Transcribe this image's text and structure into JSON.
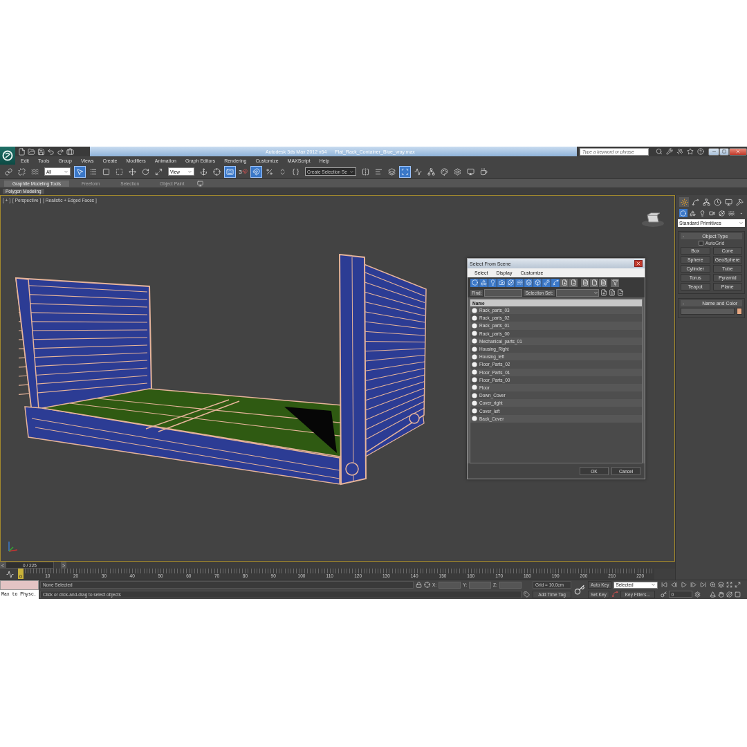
{
  "window": {
    "app_title": "Autodesk 3ds Max  2012 x64",
    "file_title": "Flat_Rack_Container_Blue_vray.max",
    "search_placeholder": "Type a keyword or phrase"
  },
  "menu": [
    "Edit",
    "Tools",
    "Group",
    "Views",
    "Create",
    "Modifiers",
    "Animation",
    "Graph Editors",
    "Rendering",
    "Customize",
    "MAXScript",
    "Help"
  ],
  "toolbar": [
    {
      "kind": "button",
      "active": false
    },
    {
      "kind": "button",
      "active": false
    },
    {
      "kind": "button",
      "active": false
    },
    {
      "kind": "dropdown",
      "value": "All"
    },
    {
      "kind": "button",
      "active": true
    },
    {
      "kind": "button",
      "active": false
    },
    {
      "kind": "button",
      "active": false
    },
    {
      "kind": "button",
      "active": false
    },
    {
      "kind": "button",
      "active": false
    },
    {
      "kind": "button",
      "active": false
    },
    {
      "kind": "button",
      "active": false
    },
    {
      "kind": "dropdown",
      "value": "View"
    },
    {
      "kind": "button",
      "active": false
    },
    {
      "kind": "button",
      "active": false
    },
    {
      "kind": "button",
      "active": true
    },
    {
      "kind": "text",
      "label": "3",
      "active": false
    },
    {
      "kind": "button",
      "active": true
    },
    {
      "kind": "button",
      "active": false
    },
    {
      "kind": "button",
      "active": false
    },
    {
      "kind": "button",
      "active": false
    },
    {
      "kind": "dropdown",
      "value": "Create Selection Se"
    },
    {
      "kind": "button",
      "active": false
    },
    {
      "kind": "button",
      "active": false
    },
    {
      "kind": "button",
      "active": false
    },
    {
      "kind": "button",
      "active": true
    },
    {
      "kind": "button",
      "active": false
    },
    {
      "kind": "button",
      "active": false
    },
    {
      "kind": "button",
      "active": false
    },
    {
      "kind": "button",
      "active": false
    },
    {
      "kind": "button",
      "active": false
    },
    {
      "kind": "button",
      "active": false
    }
  ],
  "ribbon": {
    "tabs": [
      {
        "label": "Graphite Modeling Tools",
        "selected": true
      },
      {
        "label": "Freeform",
        "selected": false
      },
      {
        "label": "Selection",
        "selected": false
      },
      {
        "label": "Object Paint",
        "selected": false
      }
    ],
    "panel": "Polygon Modeling"
  },
  "viewport": {
    "labels": [
      "[ + ]",
      "[ Perspective ]",
      "[ Realistic + Edged Faces ]"
    ]
  },
  "dialog": {
    "title": "Select From Scene",
    "menu": [
      "Select",
      "Display",
      "Customize"
    ],
    "tools": [
      {
        "active": true
      },
      {
        "active": true
      },
      {
        "active": true
      },
      {
        "active": true
      },
      {
        "active": true
      },
      {
        "active": true
      },
      {
        "active": true
      },
      {
        "active": true
      },
      {
        "active": true
      },
      {
        "active": true
      },
      {
        "active": false
      },
      {
        "active": false
      },
      {
        "active": false
      },
      {
        "active": false
      },
      {
        "active": false
      },
      {
        "active": false
      }
    ],
    "find_label": "Find:",
    "selection_set_label": "Selection Set:",
    "column": "Name",
    "items": [
      "Rack_parts_03",
      "Rack_parts_02",
      "Rack_parts_01",
      "Rack_parts_00",
      "Mechanical_parts_01",
      "Housing_Right",
      "Housing_left",
      "Floor_Parts_02",
      "Floor_Parts_01",
      "Floor_Parts_00",
      "Floor",
      "Down_Cover",
      "Cover_right",
      "Cover_left",
      "Back_Cover"
    ],
    "buttons": [
      "OK",
      "Cancel"
    ]
  },
  "command_panel": {
    "tabs": [
      {
        "selected": true
      },
      {
        "selected": false
      },
      {
        "selected": false
      },
      {
        "selected": false
      },
      {
        "selected": false
      },
      {
        "selected": false
      }
    ],
    "categories": [
      {
        "selected": true
      },
      {
        "selected": false
      },
      {
        "selected": false
      },
      {
        "selected": false
      },
      {
        "selected": false
      },
      {
        "selected": false
      },
      {
        "selected": false
      }
    ],
    "type": "Standard Primitives",
    "object_type": {
      "toggle": "-",
      "title": "Object Type",
      "autogrid": {
        "label": "AutoGrid",
        "checked": false
      },
      "buttons": [
        "Box",
        "Cone",
        "Sphere",
        "GeoSphere",
        "Cylinder",
        "Tube",
        "Torus",
        "Pyramid",
        "Teapot",
        "Plane"
      ]
    },
    "name_and_color": {
      "toggle": "-",
      "title": "Name and Color",
      "color": "#e8a882"
    }
  },
  "time_slider": {
    "prev": "<",
    "next": ">",
    "frame": "0 / 225",
    "level": 0
  },
  "track_bar": {
    "marker": "0",
    "ticks": [
      "10",
      "20",
      "30",
      "40",
      "50",
      "60",
      "70",
      "80",
      "90",
      "100",
      "110",
      "120",
      "130",
      "140",
      "150",
      "160",
      "170",
      "180",
      "190",
      "200",
      "210",
      "220"
    ]
  },
  "status": {
    "listener": "Max to Physc.",
    "selection": "None Selected",
    "prompt": "Click or click-and-drag to select objects",
    "x_label": "X:",
    "y_label": "Y:",
    "z_label": "Z:",
    "grid": "Grid = 10,0cm",
    "add_time_tag": "Add Time Tag",
    "auto_key": "Auto Key",
    "key_mode": "Selected",
    "set_key": "Set Key",
    "key_filters": "Key Filters...",
    "frame": "0"
  }
}
